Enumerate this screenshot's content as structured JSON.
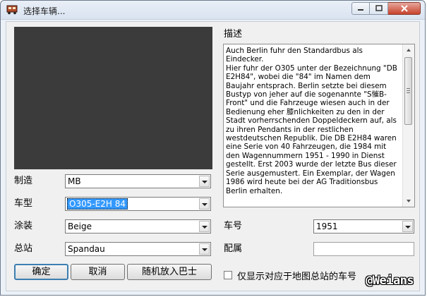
{
  "window": {
    "title": "选择车辆..."
  },
  "labels": {
    "manufacturer": "制造",
    "model": "车型",
    "livery": "涂装",
    "depot": "总站",
    "description": "描述",
    "fleet_number": "车号",
    "assigned": "配属"
  },
  "fields": {
    "manufacturer": "MB",
    "model": "O305-E2H 84",
    "livery": "Beige",
    "depot": "Spandau",
    "fleet_number": "1951",
    "assigned": ""
  },
  "description_text": "Auch Berlin fuhr den Standardbus als Eindecker.\nHier fuhr der O305 unter der Bezeichnung \"DB E2H84\", wobei die \"84\" im Namen dem Baujahr entsprach. Berlin setzte bei diesem Bustyp von jeher auf die sogenannte \"S慛B-Front\" und die Fahrzeuge wiesen auch in der Bedienung eher 膝nlichkeiten zu den in der Stadt vorherrschenden Doppeldeckern auf, als zu ihren Pendants in der restlichen westdeutschen Republik. Die DB E2H84 waren eine Serie von 40 Fahrzeugen, die 1984 mit den Wagennummern 1951 - 1990 in Dienst gestellt. Erst 2003 wurde der letzte Bus dieser Serie ausgemustert. Ein Exemplar, der Wagen 1986 wird heute bei der AG Traditionsbus Berlin erhalten.",
  "buttons": {
    "ok": "确定",
    "cancel": "取消",
    "random": "随机放入巴士"
  },
  "checkbox": {
    "label": "仅显示对应于地图总站的车号",
    "checked": false
  },
  "watermark": "@Weians"
}
